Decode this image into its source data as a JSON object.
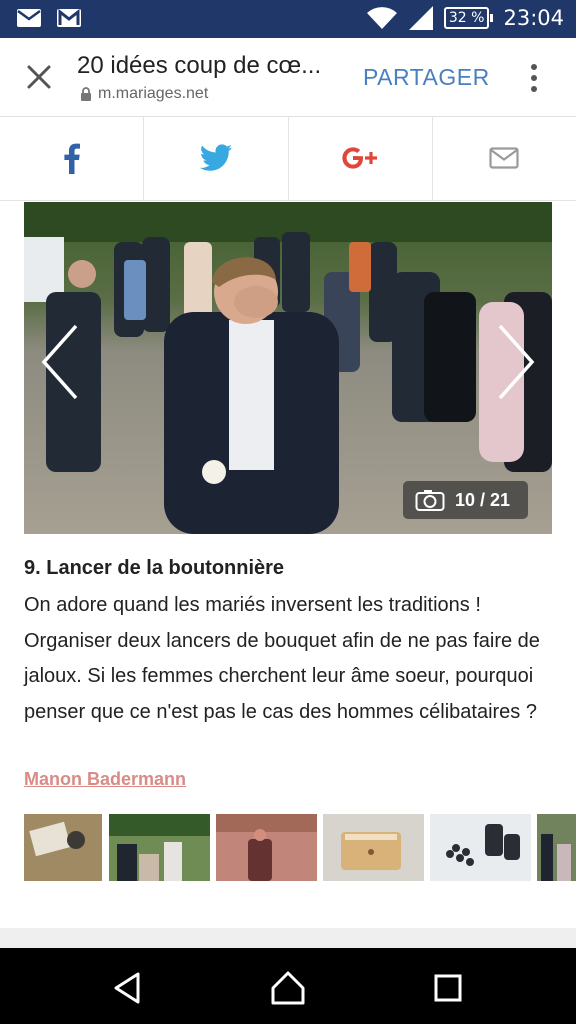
{
  "status_bar": {
    "battery": "32 %",
    "time": "23:04"
  },
  "toolbar": {
    "title": "20 idées coup de cœ...",
    "url": "m.mariages.net",
    "share_label": "PARTAGER"
  },
  "share_bar": {
    "items": [
      "facebook-icon",
      "twitter-icon",
      "google-plus-icon",
      "mail-icon"
    ],
    "facebook_color": "#2f62a6",
    "twitter_color": "#38a8e0",
    "google_color": "#e0463a",
    "mail_color": "#9a9a9a"
  },
  "gallery": {
    "counter": "10 / 21",
    "current": 10,
    "total": 21
  },
  "article": {
    "title": "9. Lancer de la boutonnière",
    "description": "On adore quand les mariés inversent les traditions ! Organiser deux lancers de bouquet afin de ne pas faire de jaloux. Si les femmes cherchent leur âme soeur, pourquoi penser que ce n'est pas le cas des hommes célibataires ?",
    "author": "Manon Badermann",
    "author_color": "#d98b86"
  },
  "thumbnails": {
    "count": 6,
    "active_index": 2
  }
}
